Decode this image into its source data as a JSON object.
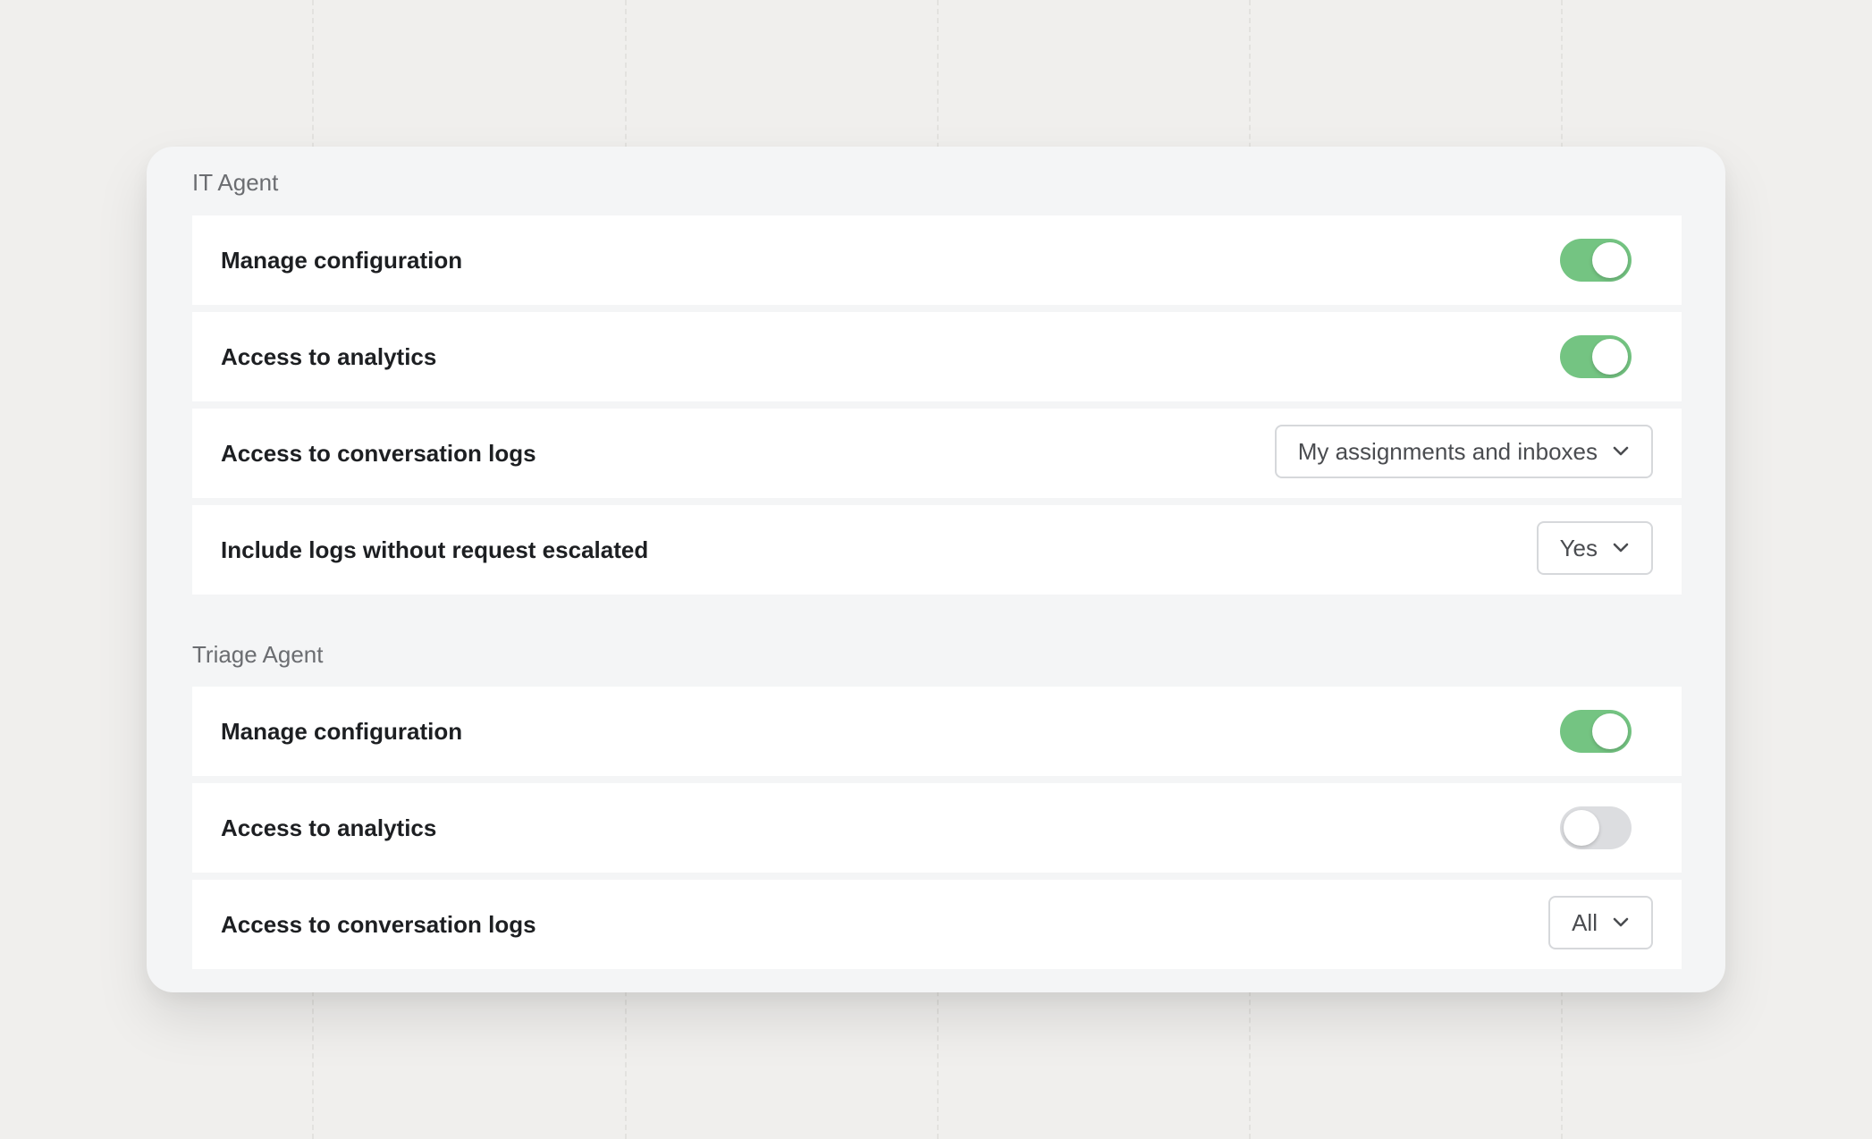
{
  "sections": [
    {
      "title": "IT Agent",
      "rows": [
        {
          "label": "Manage configuration",
          "control": "toggle",
          "on": true
        },
        {
          "label": "Access to analytics",
          "control": "toggle",
          "on": true
        },
        {
          "label": "Access to conversation logs",
          "control": "dropdown",
          "value": "My assignments and inboxes"
        },
        {
          "label": "Include logs without request escalated",
          "control": "dropdown",
          "value": "Yes"
        }
      ]
    },
    {
      "title": "Triage Agent",
      "rows": [
        {
          "label": "Manage configuration",
          "control": "toggle",
          "on": true
        },
        {
          "label": "Access to analytics",
          "control": "toggle",
          "on": false
        },
        {
          "label": "Access to conversation logs",
          "control": "dropdown",
          "value": "All"
        }
      ]
    }
  ],
  "colors": {
    "toggle_on": "#74c482",
    "toggle_off": "#dcdde0",
    "background": "#f0efed",
    "card": "#f4f5f6"
  },
  "icons": {
    "dropdown": "chevron-down-icon"
  }
}
